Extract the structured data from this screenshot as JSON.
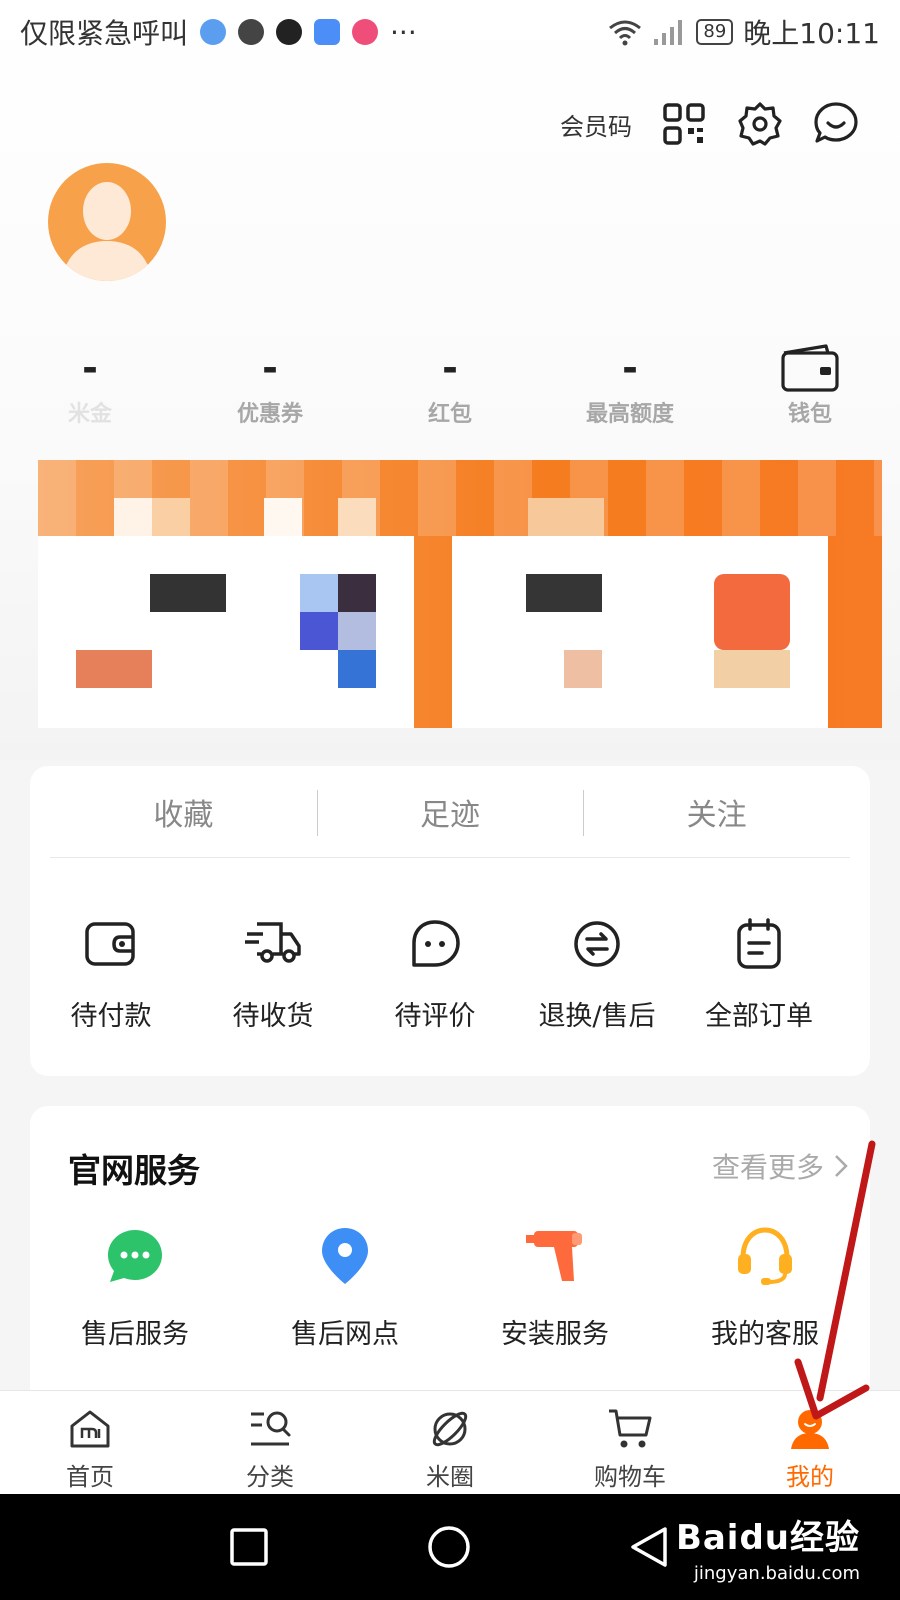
{
  "status_bar": {
    "left_text": "仅限紧急呼叫",
    "more": "···",
    "battery": "89",
    "time": "晚上10:11"
  },
  "header": {
    "member_code_label": "会员码"
  },
  "stats": [
    {
      "value": "-",
      "label": "米金"
    },
    {
      "value": "-",
      "label": "优惠券"
    },
    {
      "value": "-",
      "label": "红包"
    },
    {
      "value": "-",
      "label": "最高额度"
    },
    {
      "value": "",
      "label": "钱包"
    }
  ],
  "quick_tabs": [
    "收藏",
    "足迹",
    "关注"
  ],
  "orders": [
    {
      "label": "待付款",
      "icon": "wallet-icon"
    },
    {
      "label": "待收货",
      "icon": "delivery-truck-icon"
    },
    {
      "label": "待评价",
      "icon": "comment-icon"
    },
    {
      "label": "退换/售后",
      "icon": "exchange-icon"
    },
    {
      "label": "全部订单",
      "icon": "order-list-icon"
    }
  ],
  "services": {
    "title": "官网服务",
    "more": "查看更多",
    "items": [
      {
        "label": "售后服务",
        "icon": "chat-bubble-icon",
        "color": "#2dc36a"
      },
      {
        "label": "售后网点",
        "icon": "location-pin-icon",
        "color": "#3d8ff5"
      },
      {
        "label": "安装服务",
        "icon": "drill-icon",
        "color": "#ff6a3d"
      },
      {
        "label": "我的客服",
        "icon": "headset-icon",
        "color": "#ffb020"
      }
    ]
  },
  "bottom_nav": [
    {
      "label": "首页",
      "icon": "home-icon"
    },
    {
      "label": "分类",
      "icon": "category-search-icon"
    },
    {
      "label": "米圈",
      "icon": "planet-icon"
    },
    {
      "label": "购物车",
      "icon": "cart-icon"
    },
    {
      "label": "我的",
      "icon": "profile-icon",
      "active": true
    }
  ],
  "colors": {
    "accent": "#ff6900",
    "banner": "#f57c1f"
  },
  "watermark": {
    "main": "Baidu经验",
    "sub": "jingyan.baidu.com"
  }
}
